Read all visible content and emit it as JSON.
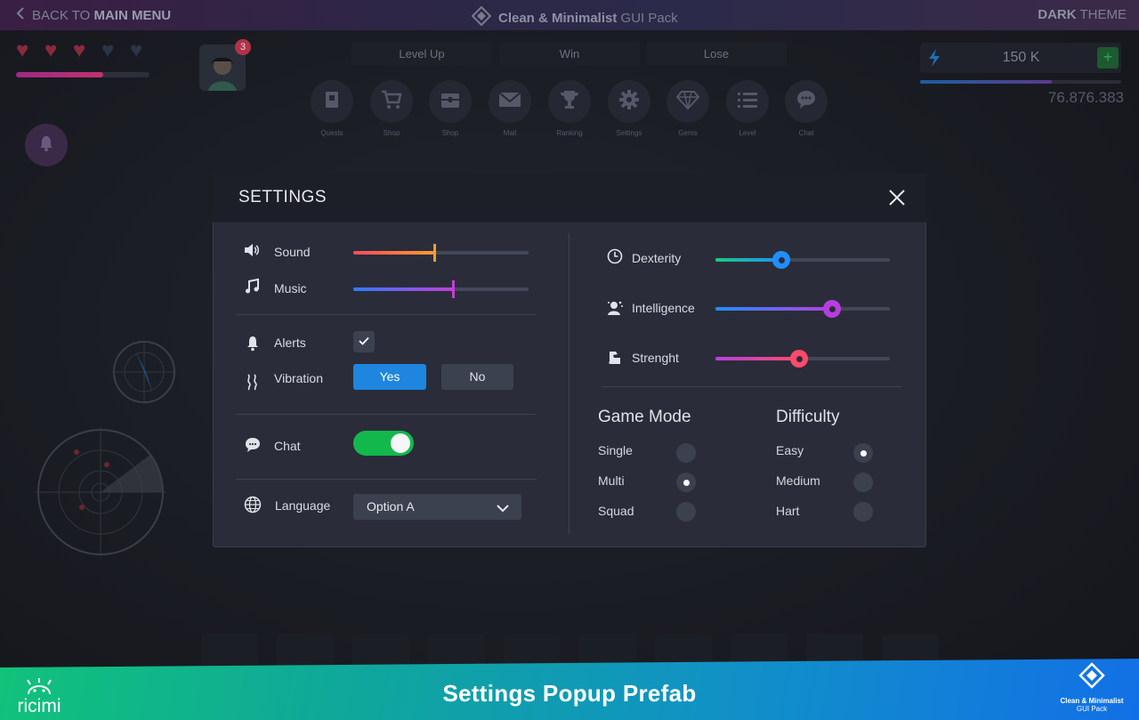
{
  "topbar": {
    "back_prefix": "BACK TO ",
    "back_strong": "MAIN MENU",
    "pack_strong": "Clean & Minimalist",
    "pack_rest": " GUI Pack",
    "theme_strong": "DARK",
    "theme_rest": " THEME"
  },
  "player": {
    "hearts_filled": 3,
    "hearts_total": 5,
    "health_level": 0.65,
    "notification_count": "3"
  },
  "top_buttons": [
    "Level Up",
    "Win",
    "Lose"
  ],
  "menu": [
    {
      "label": "Quests",
      "icon": "book-icon"
    },
    {
      "label": "Shop",
      "icon": "cart-icon"
    },
    {
      "label": "Shop",
      "icon": "chest-icon"
    },
    {
      "label": "Mail",
      "icon": "mail-icon"
    },
    {
      "label": "Ranking",
      "icon": "trophy-icon"
    },
    {
      "label": "Settings",
      "icon": "gear-icon"
    },
    {
      "label": "Gems",
      "icon": "gem-icon"
    },
    {
      "label": "Level",
      "icon": "list-icon"
    },
    {
      "label": "Chat",
      "icon": "chat-icon"
    }
  ],
  "currency": {
    "value": "150 K",
    "plus": "+",
    "xp_level": 0.65,
    "score": "76.876.383"
  },
  "settings": {
    "title": "SETTINGS",
    "sound": {
      "label": "Sound",
      "level": 0.46
    },
    "music": {
      "label": "Music",
      "level": 0.57
    },
    "alerts": {
      "label": "Alerts",
      "checked": true
    },
    "vibration": {
      "label": "Vibration",
      "yes": "Yes",
      "no": "No",
      "selected": "Yes"
    },
    "chat": {
      "label": "Chat",
      "on": true
    },
    "language": {
      "label": "Language",
      "value": "Option A"
    },
    "dexterity": {
      "label": "Dexterity",
      "level": 0.38
    },
    "intelligence": {
      "label": "Intelligence",
      "level": 0.67
    },
    "strength": {
      "label": "Strenght",
      "level": 0.48
    },
    "game_mode": {
      "title": "Game Mode",
      "options": [
        "Single",
        "Multi",
        "Squad"
      ],
      "selected": "Multi"
    },
    "difficulty": {
      "title": "Difficulty",
      "options": [
        "Easy",
        "Medium",
        "Hart"
      ],
      "selected": "Easy"
    }
  },
  "colors": {
    "sound_gradient": [
      "#ff4a5c",
      "#ff9a2e"
    ],
    "music_gradient": [
      "#2f7bff",
      "#c33fd8"
    ],
    "dexterity_gradient": [
      "#1ec97e",
      "#1f8fff"
    ],
    "intelligence_gradient": [
      "#1f8fff",
      "#b63ee0"
    ],
    "strength_gradient": [
      "#b640e0",
      "#ff4a6a"
    ],
    "toggle_on": "#13b84d",
    "primary_button": "#1e86df"
  },
  "footer": {
    "title": "Settings Popup Prefab",
    "brand": "ricimi",
    "pack_line1": "Clean & Minimalist",
    "pack_line2": "GUI Pack"
  }
}
